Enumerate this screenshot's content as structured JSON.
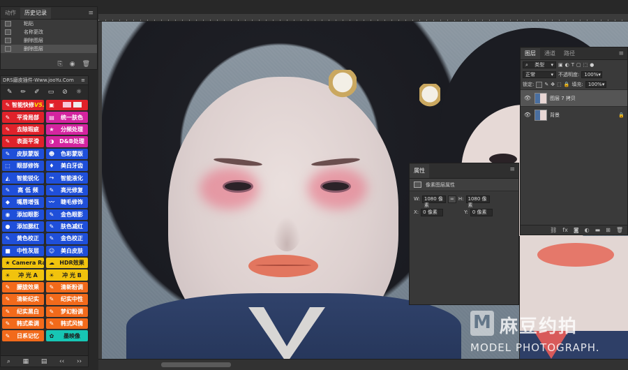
{
  "history_panel": {
    "tabs": [
      "动作",
      "历史记录"
    ],
    "active_tab": 1,
    "items": [
      "粘贴",
      "名称更改",
      "删除图层",
      "删除图层"
    ],
    "selected_index": 3
  },
  "drs_panel": {
    "title": "DRS磨皮插件-Www.jooYu.Com",
    "tool_icons": [
      "brush-icon",
      "ruler-icon",
      "eraser-icon",
      "rect-icon",
      "bandaid-icon",
      "sun-icon"
    ],
    "buttons": [
      {
        "label": "智能快修",
        "suffix": "V5.0",
        "color": "#e0222a",
        "icon": "brush-icon"
      },
      {
        "label": "",
        "color": "#e0222a",
        "icon": "palette-icon",
        "extra": "color-swatches"
      },
      {
        "label": "平滑局部",
        "color": "#e0222a",
        "icon": "brush-icon"
      },
      {
        "label": "统一肤色",
        "color": "#d4249f",
        "icon": "layers-icon"
      },
      {
        "label": "去除瑕疵",
        "color": "#e0222a",
        "icon": "brush-icon"
      },
      {
        "label": "分频处理",
        "color": "#d4249f",
        "icon": "star-icon"
      },
      {
        "label": "表面平滑",
        "color": "#e0222a",
        "icon": "brush-icon"
      },
      {
        "label": "D&B处理",
        "color": "#d4249f",
        "icon": "contrast-icon"
      },
      {
        "label": "皮肤蒙版",
        "color": "#1f4fd9",
        "icon": "brush-icon"
      },
      {
        "label": "色彩蒙版",
        "color": "#1f4fd9",
        "icon": "mask-icon"
      },
      {
        "label": "眼部修饰",
        "color": "#1f4fd9",
        "icon": "select-icon"
      },
      {
        "label": "美白牙齿",
        "color": "#1f4fd9",
        "icon": "tooth-icon"
      },
      {
        "label": "智能锐化",
        "color": "#1f4fd9",
        "icon": "triangle-icon"
      },
      {
        "label": "智能液化",
        "color": "#1f4fd9",
        "icon": "liquify-icon"
      },
      {
        "label": "高  低  频",
        "color": "#1f4fd9",
        "icon": "brush-icon"
      },
      {
        "label": "高光修复",
        "color": "#1f4fd9",
        "icon": "brush-icon"
      },
      {
        "label": "嘴唇增强",
        "color": "#1f4fd9",
        "icon": "lips-icon"
      },
      {
        "label": "睫毛修饰",
        "color": "#1f4fd9",
        "icon": "lash-icon"
      },
      {
        "label": "添加眼影",
        "color": "#1f4fd9",
        "icon": "eye-icon"
      },
      {
        "label": "金色眼影",
        "color": "#1f4fd9",
        "icon": "brush-icon"
      },
      {
        "label": "添加腮红",
        "color": "#1f4fd9",
        "icon": "blush-icon"
      },
      {
        "label": "肤色减红",
        "color": "#1f4fd9",
        "icon": "brush-icon"
      },
      {
        "label": "黄色校正",
        "color": "#1f4fd9",
        "icon": "brush-icon"
      },
      {
        "label": "金色校正",
        "color": "#1f4fd9",
        "icon": "brush-icon"
      },
      {
        "label": "中性灰层",
        "color": "#1f4fd9",
        "icon": "square-icon"
      },
      {
        "label": "美白皮肤",
        "color": "#1f4fd9",
        "icon": "face-icon"
      },
      {
        "label": "Camera Raw",
        "color": "#f1c30d",
        "icon": "star-icon"
      },
      {
        "label": "HDR效果",
        "color": "#f1c30d",
        "icon": "cloud-icon"
      },
      {
        "label": "冲  光  A",
        "color": "#f1c30d",
        "icon": "sun-icon"
      },
      {
        "label": "冲  光  B",
        "color": "#f1c30d",
        "icon": "sun-icon"
      },
      {
        "label": "朦胧效果",
        "color": "#f26a1b",
        "icon": "brush-icon"
      },
      {
        "label": "清新粉调",
        "color": "#f26a1b",
        "icon": "brush-icon"
      },
      {
        "label": "清新纪实",
        "color": "#f26a1b",
        "icon": "brush-icon"
      },
      {
        "label": "纪实中性",
        "color": "#f26a1b",
        "icon": "brush-icon"
      },
      {
        "label": "纪实黑白",
        "color": "#f26a1b",
        "icon": "brush-icon"
      },
      {
        "label": "梦幻粉调",
        "color": "#f26a1b",
        "icon": "brush-icon"
      },
      {
        "label": "韩式柔调",
        "color": "#f26a1b",
        "icon": "brush-icon"
      },
      {
        "label": "韩式风情",
        "color": "#f26a1b",
        "icon": "brush-icon"
      },
      {
        "label": "日系记忆",
        "color": "#f26a1b",
        "icon": "brush-icon"
      },
      {
        "label": "墨映像",
        "color": "#17c6b4",
        "icon": "ink-icon"
      }
    ],
    "footer_icons": [
      "search-icon",
      "film-icon",
      "grid-icon",
      "prev-icon",
      "next-icon"
    ]
  },
  "layers_panel": {
    "tabs": [
      "图层",
      "通道",
      "路径"
    ],
    "active_tab": 0,
    "filter_label": "类型",
    "blend_mode": "正常",
    "opacity_label": "不透明度:",
    "opacity_value": "100%",
    "lock_label": "锁定:",
    "fill_label": "填充:",
    "fill_value": "100%",
    "layers": [
      {
        "name": "图层 7 拷贝",
        "selected": true,
        "locked": false
      },
      {
        "name": "背景",
        "selected": false,
        "locked": true
      }
    ],
    "footer_icons": [
      "link-icon",
      "fx-icon",
      "mask-icon",
      "adjustment-icon",
      "folder-icon",
      "new-layer-icon",
      "trash-icon"
    ]
  },
  "properties_panel": {
    "title": "属性",
    "subtitle": "像素图层属性",
    "w_label": "W:",
    "w_value": "1080 像素",
    "h_label": "H:",
    "h_value": "1080 像素",
    "x_label": "X:",
    "x_value": "0 像素",
    "y_label": "Y:",
    "y_value": "0 像素"
  },
  "watermark": {
    "cn": "麻豆约拍",
    "en": "MODEL PHOTOGRAPH."
  }
}
